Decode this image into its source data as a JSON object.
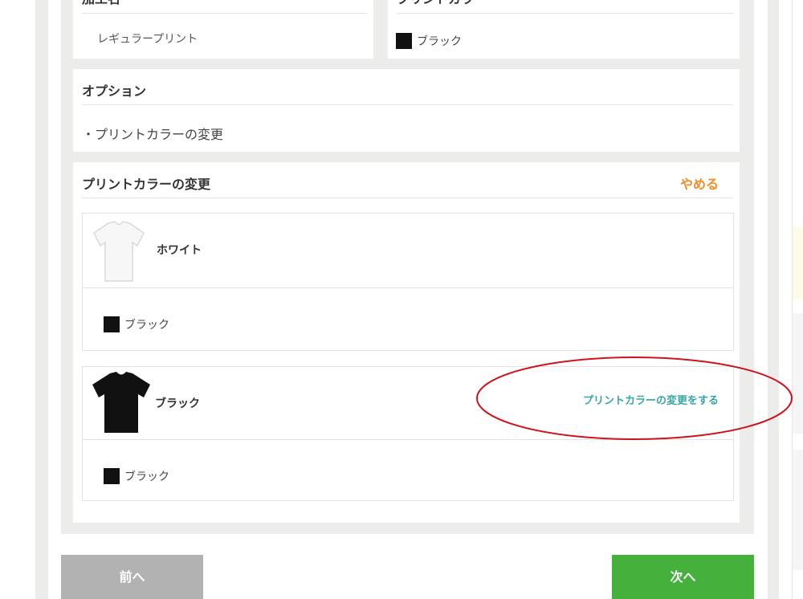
{
  "print_method": {
    "title": "加工名",
    "value": "レギュラープリント"
  },
  "print_color": {
    "title": "プリントカラー",
    "value": "ブラック"
  },
  "options": {
    "title": "オプション",
    "item": "・プリントカラーの変更"
  },
  "color_change": {
    "title": "プリントカラーの変更",
    "cancel_label": "やめる",
    "items": [
      {
        "name": "ホワイト",
        "print_color": "ブラック",
        "shirt_color": "#f7f7f7"
      },
      {
        "name": "ブラック",
        "action_label": "プリントカラーの変更をする",
        "print_color": "ブラック",
        "shirt_color": "#111111"
      }
    ]
  },
  "nav": {
    "prev_label": "前へ",
    "next_label": "次へ"
  },
  "colors": {
    "accent_orange": "#f28c28",
    "action_teal": "#34a7a2",
    "next_green": "#45b03c",
    "prev_gray": "#b2b2b2",
    "annotation_red": "#d0121c"
  }
}
